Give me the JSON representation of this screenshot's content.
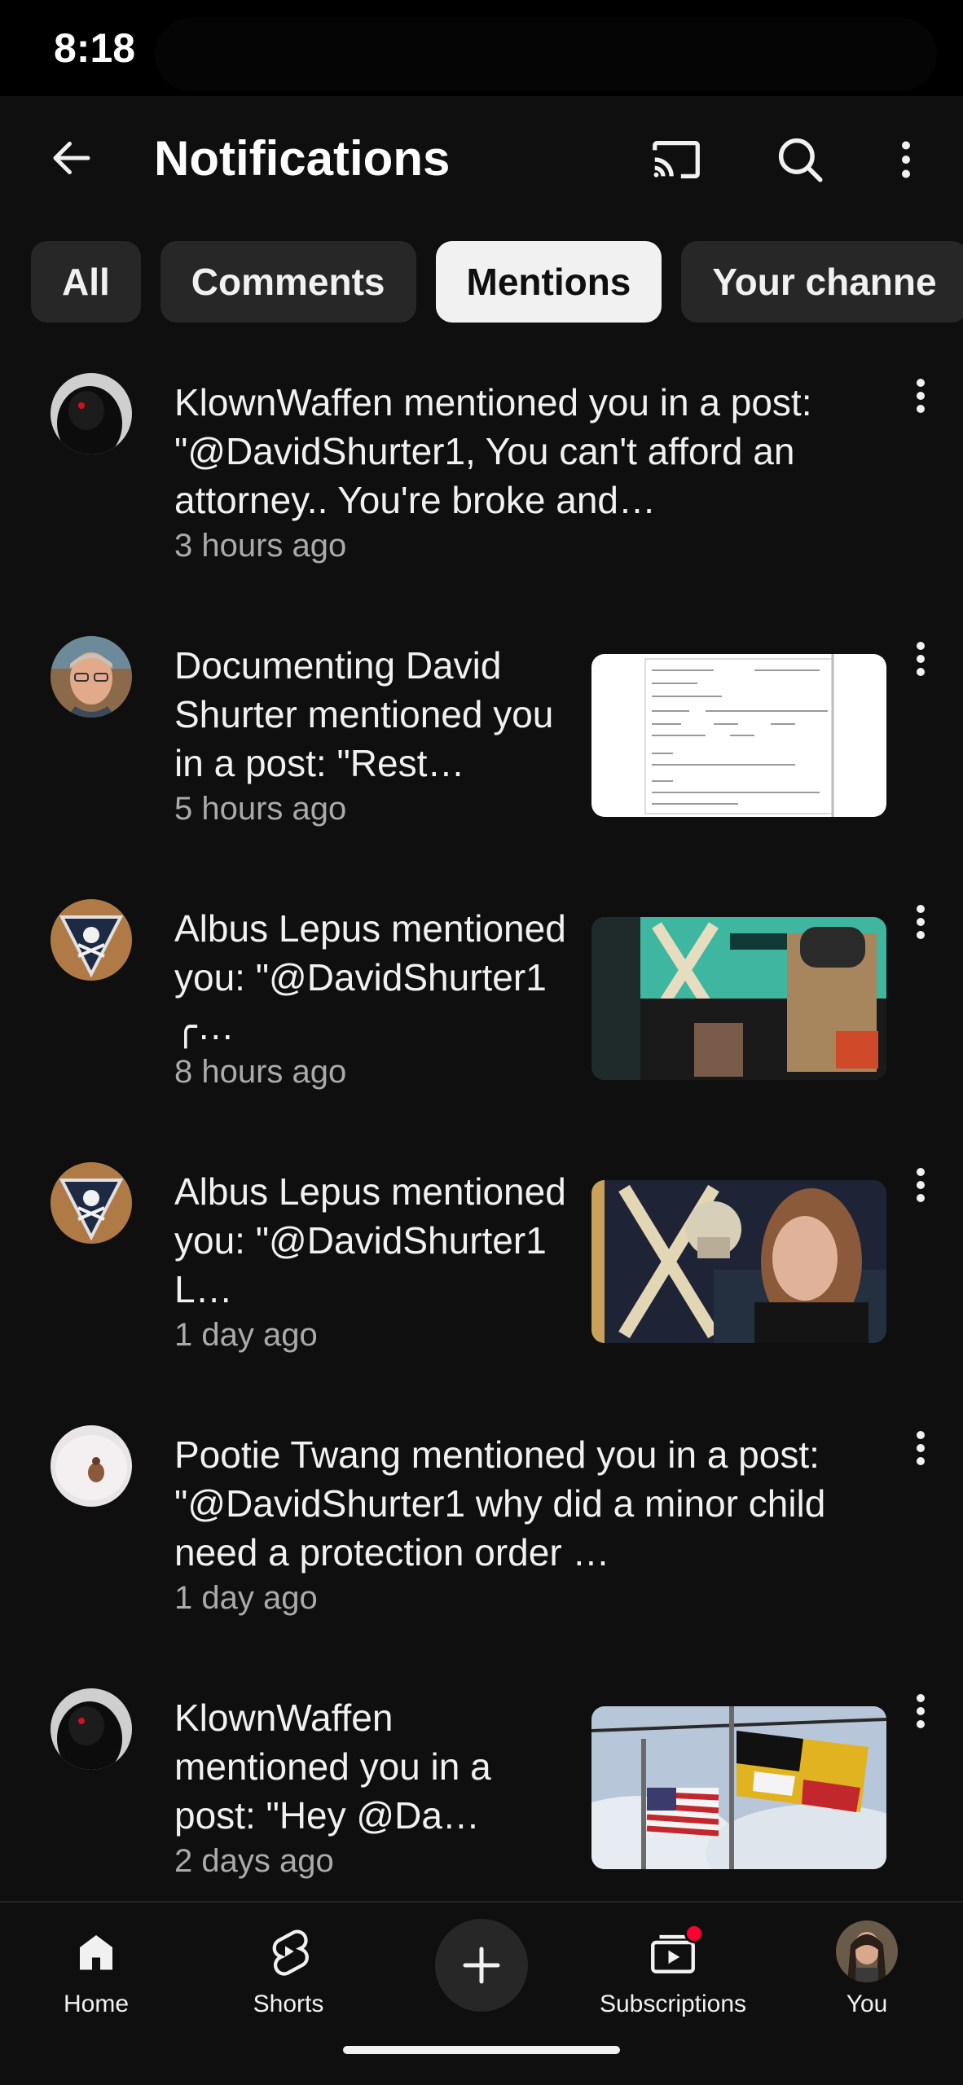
{
  "status_bar": {
    "time": "8:18"
  },
  "header": {
    "title": "Notifications"
  },
  "chips": [
    {
      "label": "All",
      "active": false
    },
    {
      "label": "Comments",
      "active": false
    },
    {
      "label": "Mentions",
      "active": true
    },
    {
      "label": "Your channe",
      "active": false
    }
  ],
  "notifications": [
    {
      "text": "KlownWaffen mentioned you in a post: \"@DavidShurter1,  You can't afford an attorney.. You're broke and…",
      "time": "3 hours ago",
      "avatar": "hooded-figure",
      "thumbnail": null
    },
    {
      "text": "Documenting David Shurter mentioned you in a post: \"Rest…",
      "time": "5 hours ago",
      "avatar": "man-portrait",
      "thumbnail": "document-screenshot"
    },
    {
      "text": "Albus Lepus mentioned you: \"@DavidShurter1  ╭…",
      "time": "8 hours ago",
      "avatar": "skull-crossbones-shield",
      "thumbnail": "channel-collage"
    },
    {
      "text": "Albus Lepus mentioned you: \"@DavidShurter1  L…",
      "time": "1 day ago",
      "avatar": "skull-crossbones-shield",
      "thumbnail": "skull-and-person"
    },
    {
      "text": "Pootie Twang mentioned you in a post: \"@DavidShurter1 why did a minor child need a protection order …",
      "time": "1 day ago",
      "avatar": "round-figure",
      "thumbnail": null
    },
    {
      "text": "KlownWaffen mentioned you in a post: \"Hey @Da…",
      "time": "2 days ago",
      "avatar": "hooded-figure",
      "thumbnail": "flags-on-poles"
    }
  ],
  "bottom_nav": {
    "home": "Home",
    "shorts": "Shorts",
    "subscriptions": "Subscriptions",
    "you": "You"
  },
  "colors": {
    "background": "#0f0f0f",
    "chip": "#272727",
    "chip_active": "#f1f1f1",
    "secondary_text": "#aaaaaa",
    "badge": "#ff0033"
  }
}
